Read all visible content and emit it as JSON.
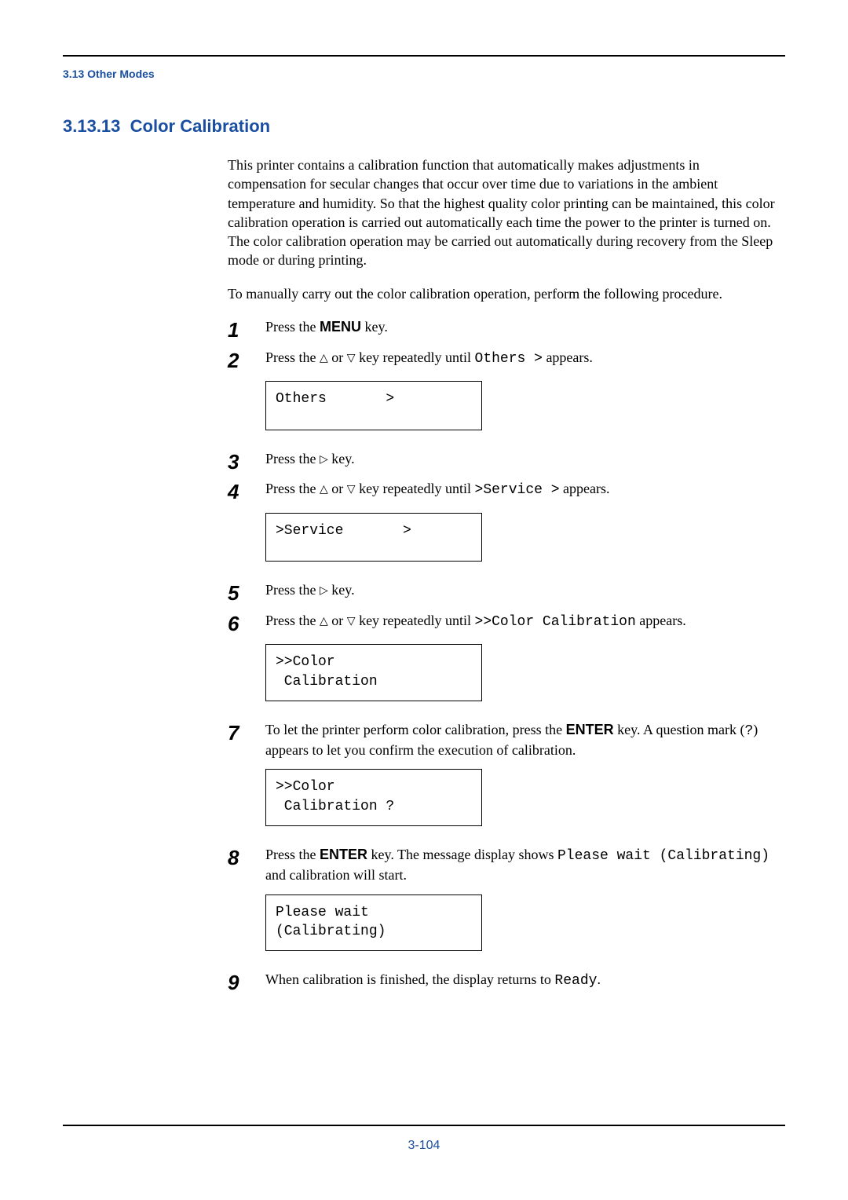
{
  "header": "3.13 Other Modes",
  "section_number": "3.13.13",
  "section_title": "Color Calibration",
  "intro1": "This printer contains a calibration function that automatically makes adjustments in compensation for secular changes that occur over time due to variations in the ambient temperature and humidity. So that the highest quality color printing can be maintained, this color calibration operation is carried out automatically each time the power to the printer is turned on. The color calibration operation may be carried out automatically during recovery from the Sleep mode or during printing.",
  "intro2": "To manually carry out the color calibration operation, perform the following procedure.",
  "steps": {
    "s1_a": "Press the ",
    "s1_b": "MENU",
    "s1_c": " key.",
    "s2_a": "Press the ",
    "s2_b": " or ",
    "s2_c": " key repeatedly until ",
    "s2_d": "Others >",
    "s2_e": " appears.",
    "disp2": "Others       >",
    "s3_a": "Press the ",
    "s3_b": " key.",
    "s4_a": "Press the ",
    "s4_b": " or ",
    "s4_c": " key repeatedly until ",
    "s4_d": ">Service  >",
    "s4_e": " appears.",
    "disp4": ">Service       >",
    "s5_a": "Press the ",
    "s5_b": " key.",
    "s6_a": "Press the ",
    "s6_b": " or ",
    "s6_c": " key repeatedly until ",
    "s6_d": ">>Color Calibration",
    "s6_e": " appears.",
    "disp6": ">>Color\n Calibration",
    "s7_a": "To let the printer perform color calibration, press the ",
    "s7_b": "ENTER",
    "s7_c": " key. A question mark (",
    "s7_d": "?",
    "s7_e": ") appears to let you confirm the execution of calibration.",
    "disp7": ">>Color\n Calibration ?",
    "s8_a": "Press the ",
    "s8_b": "ENTER",
    "s8_c": " key. The message display shows ",
    "s8_d": "Please wait (Calibrating)",
    "s8_e": " and calibration will start.",
    "disp8": "Please wait\n(Calibrating)",
    "s9_a": "When calibration is finished, the display returns to ",
    "s9_b": "Ready",
    "s9_c": "."
  },
  "nums": {
    "n1": "1",
    "n2": "2",
    "n3": "3",
    "n4": "4",
    "n5": "5",
    "n6": "6",
    "n7": "7",
    "n8": "8",
    "n9": "9"
  },
  "glyphs": {
    "up": "△",
    "down": "▽",
    "right": "▷"
  },
  "page_number": "3-104"
}
